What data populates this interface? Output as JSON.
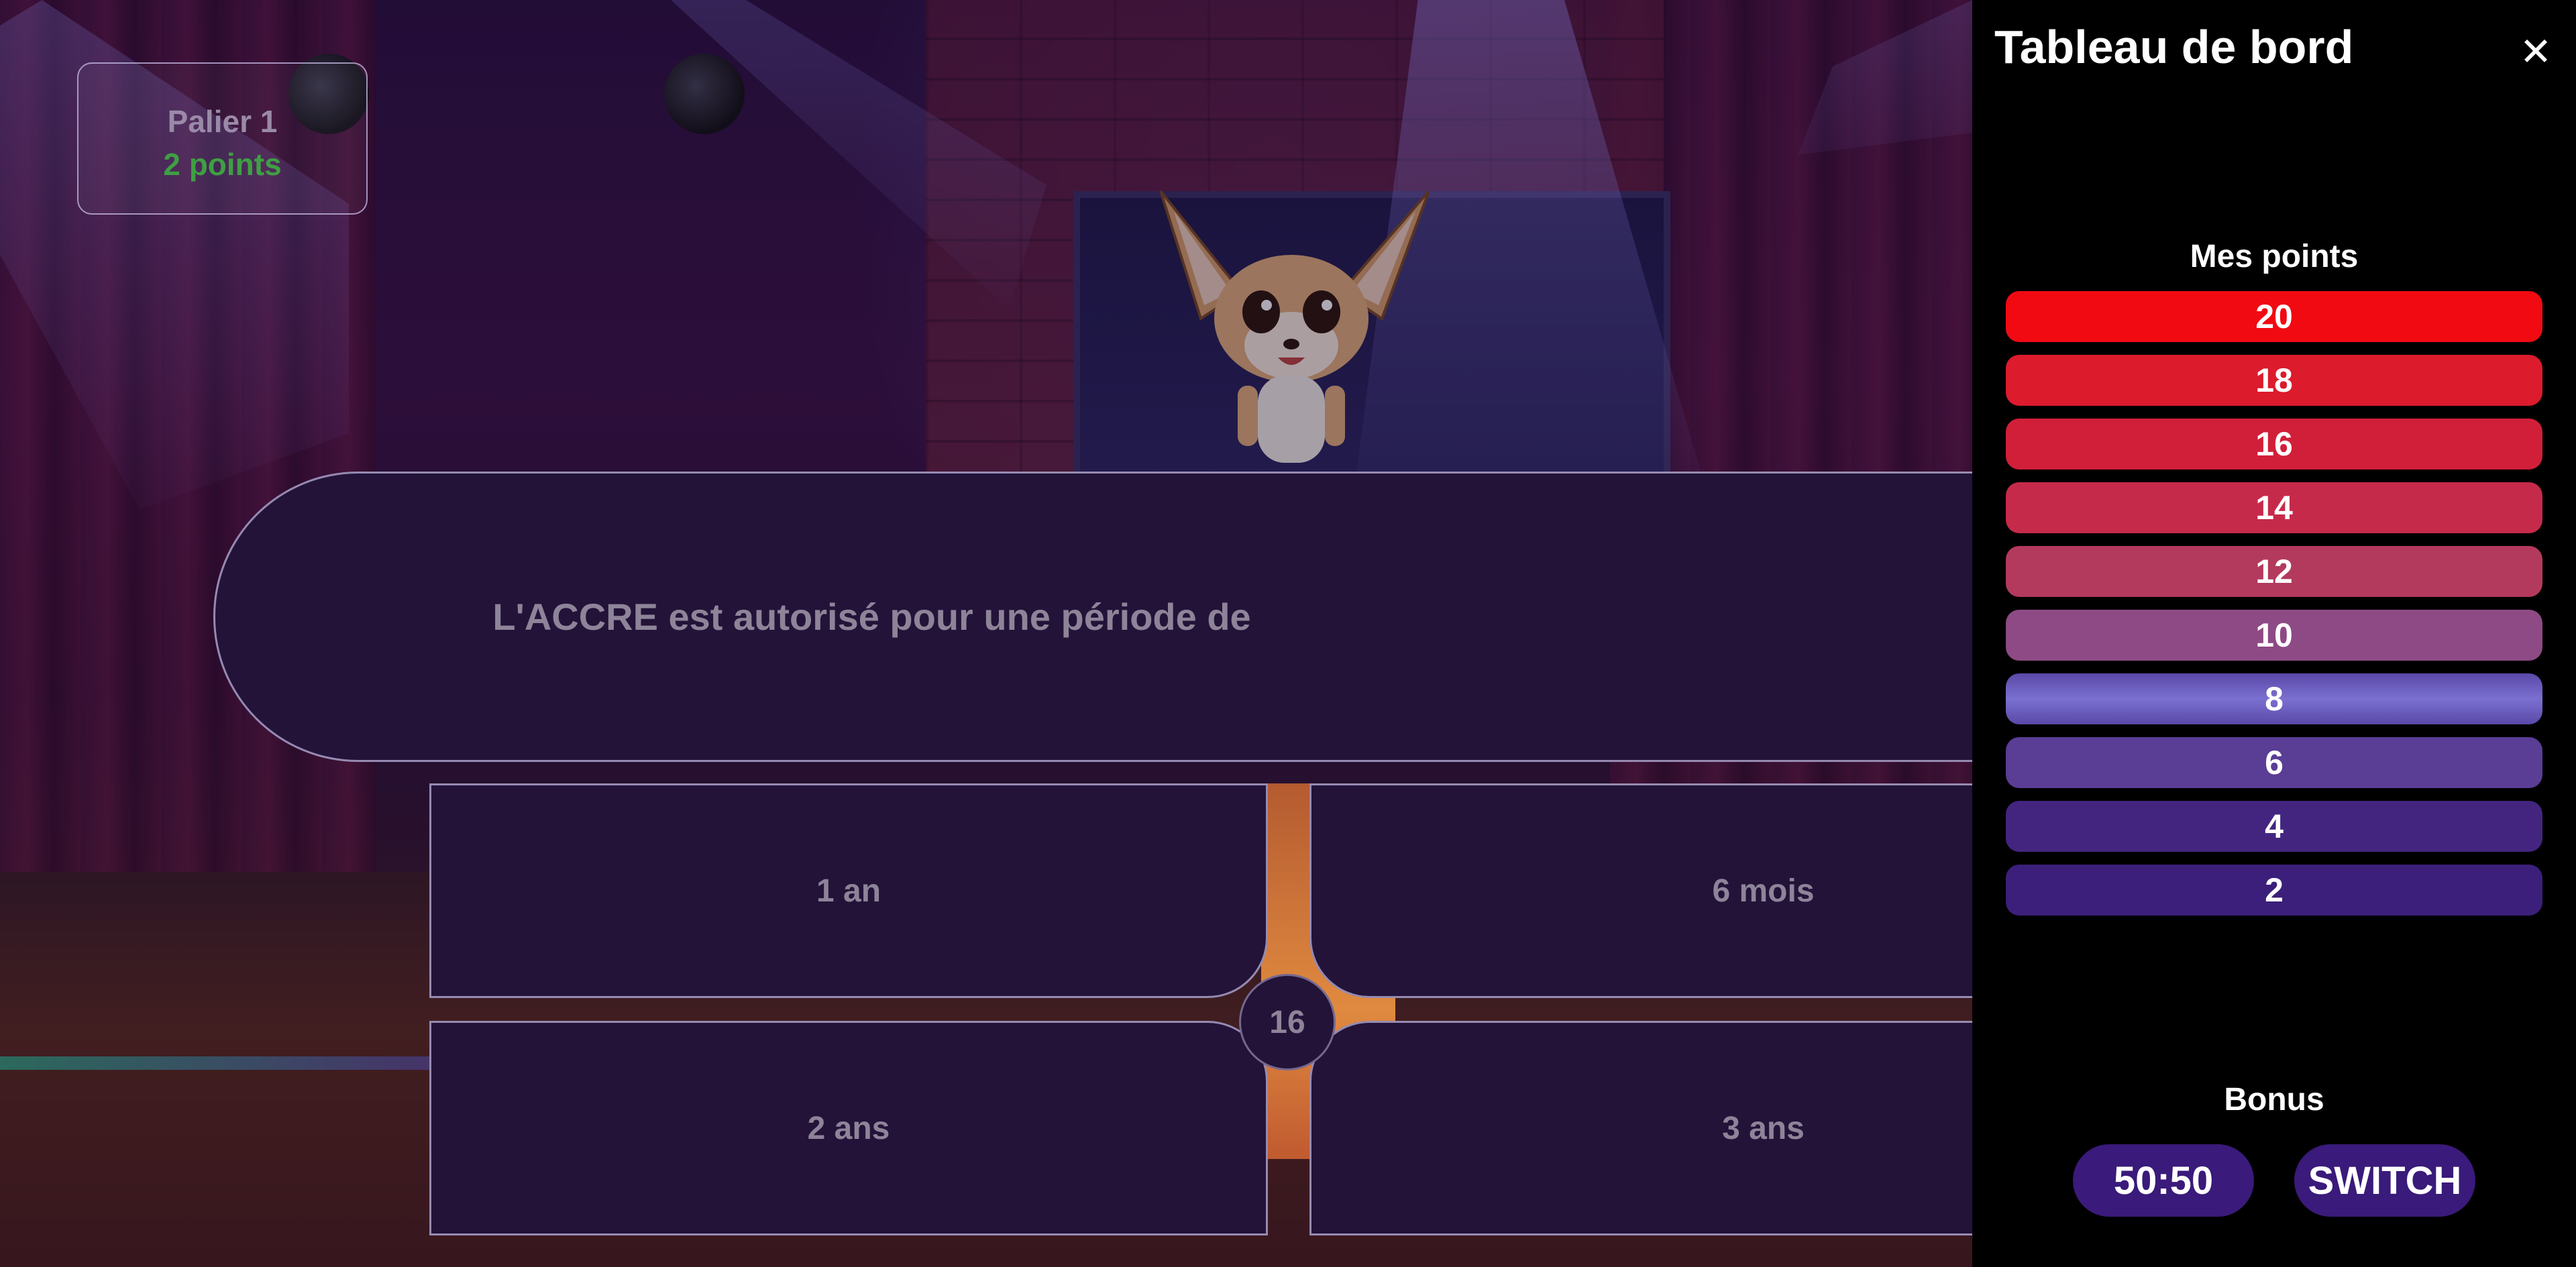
{
  "hud": {
    "level_label": "Palier 1",
    "points_label": "2 points"
  },
  "question": {
    "text": "L'ACCRE est autorisé pour une période de",
    "number": "16"
  },
  "answers": [
    {
      "label": "1 an"
    },
    {
      "label": "6 mois"
    },
    {
      "label": "2 ans"
    },
    {
      "label": "3 ans"
    }
  ],
  "panel": {
    "title": "Tableau de bord",
    "close_icon": "close-icon",
    "points_title": "Mes points",
    "points": [
      {
        "value": "20",
        "color": "#f10a12"
      },
      {
        "value": "18",
        "color": "#dc1b2d"
      },
      {
        "value": "16",
        "color": "#d11f39"
      },
      {
        "value": "14",
        "color": "#c62a4a"
      },
      {
        "value": "12",
        "color": "#b33a5d"
      },
      {
        "value": "10",
        "color": "#8e4a84"
      },
      {
        "value": "8",
        "color": "#6a60bb"
      },
      {
        "value": "6",
        "color": "#5a3d95"
      },
      {
        "value": "4",
        "color": "#432580"
      },
      {
        "value": "2",
        "color": "#3b1f7a"
      }
    ],
    "bonus_title": "Bonus",
    "bonus": {
      "fifty": "50:50",
      "switch": "SWITCH"
    }
  }
}
